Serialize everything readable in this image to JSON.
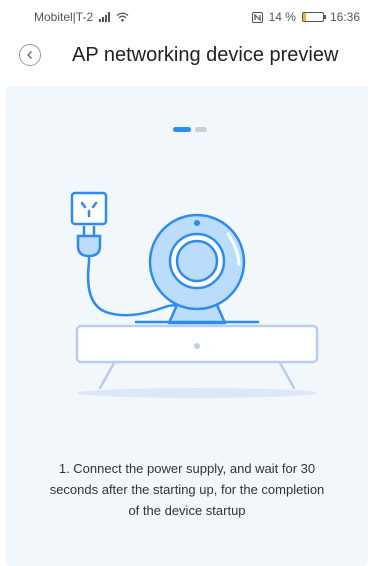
{
  "status_bar": {
    "carrier": "Mobitel|T-2",
    "battery_percent": "14 %",
    "battery_level": 0.14,
    "time": "16:36"
  },
  "header": {
    "title": "AP networking device preview"
  },
  "pager": {
    "current": 1,
    "total": 2
  },
  "instruction": {
    "text": "1. Connect the power supply, and wait for 30 seconds after the starting up, for the completion of the device startup"
  },
  "colors": {
    "accent": "#2d8cf0",
    "card_bg": "#f2f7fc",
    "illustration_fill": "#bcdcfb",
    "illustration_stroke": "#2d8cf0"
  },
  "icons": {
    "back": "chevron-left-icon",
    "signal": "signal-icon",
    "wifi": "wifi-icon",
    "nfc": "nfc-icon",
    "battery": "battery-icon"
  }
}
